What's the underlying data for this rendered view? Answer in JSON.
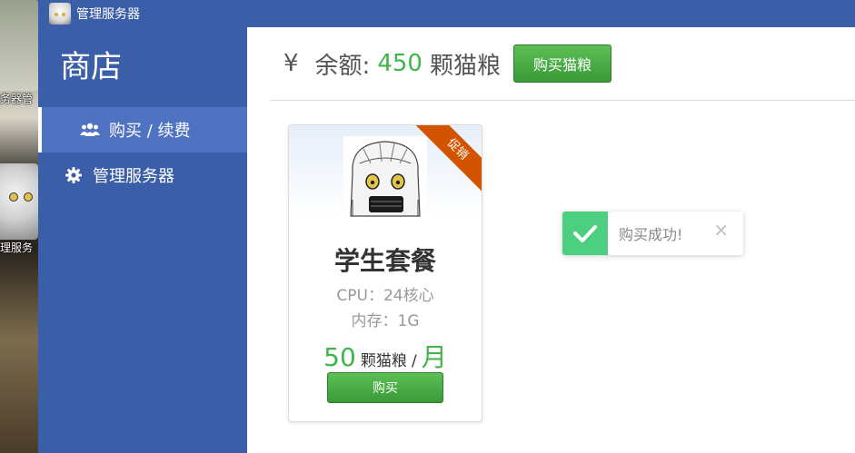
{
  "desktop": {
    "icons": [
      {
        "label": "服务器管"
      },
      {
        "label": "管理服务"
      }
    ]
  },
  "titlebar": {
    "title": "管理服务器"
  },
  "sidebar": {
    "heading": "商店",
    "items": [
      {
        "label": "购买 / 续费",
        "icon": "users-icon",
        "active": true
      },
      {
        "label": "管理服务器",
        "icon": "gear-icon",
        "active": false
      }
    ]
  },
  "balance": {
    "currency_symbol": "¥",
    "label": "余额:",
    "amount": "450",
    "unit": "颗猫粮",
    "buy_button": "购买猫粮"
  },
  "product": {
    "badge": "促销",
    "name": "学生套餐",
    "cpu": "CPU：24核心",
    "memory": "内存：1G",
    "price": "50",
    "price_unit": "颗猫粮",
    "separator": "/",
    "period": "月",
    "buy_button": "购买"
  },
  "toast": {
    "message": "购买成功!",
    "close": "×"
  },
  "colors": {
    "sidebar": "#3b5ea8",
    "sidebar_active": "#4f73c2",
    "accent_green": "#3fb54a",
    "badge": "#d35400",
    "toast_check": "#4cd080"
  }
}
